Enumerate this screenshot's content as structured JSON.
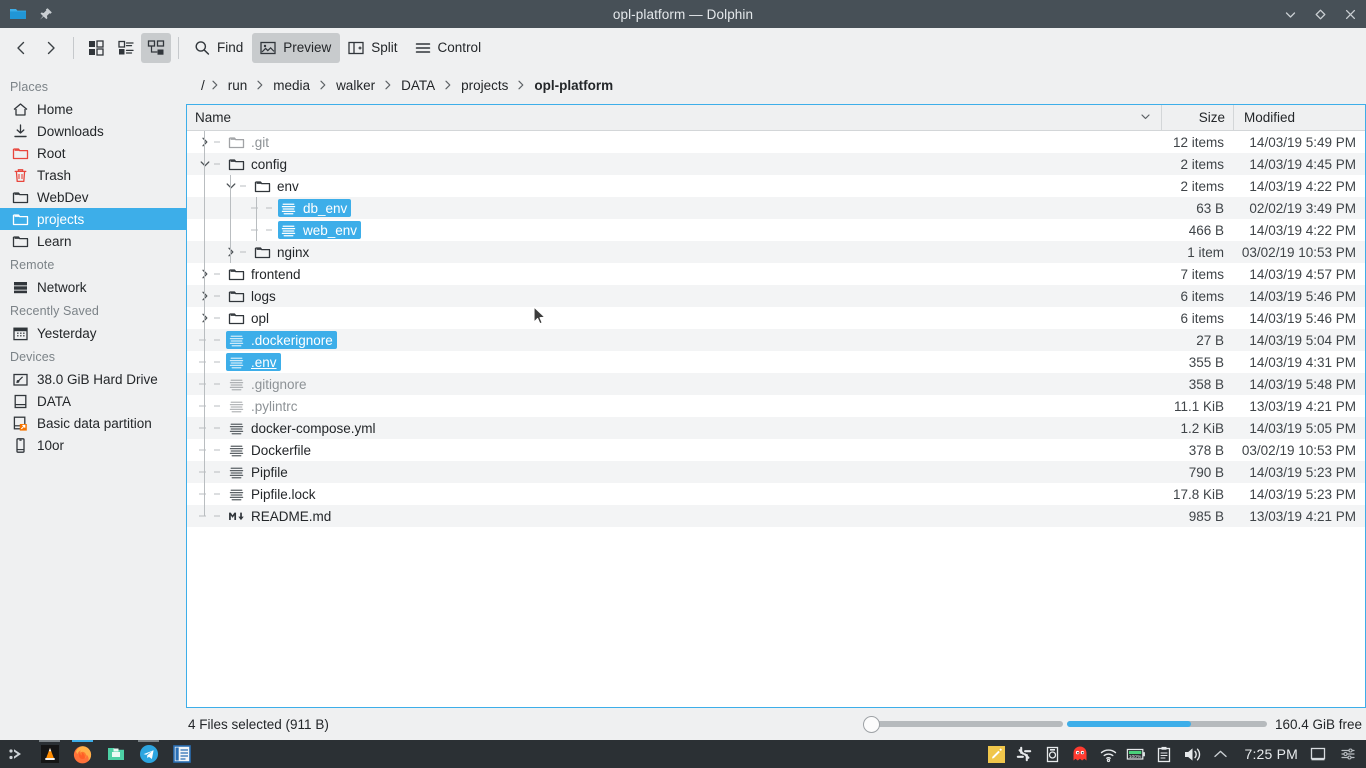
{
  "window": {
    "title": "opl-platform — Dolphin",
    "app_icon": "folder-icon",
    "pin_icon": "pin-icon",
    "controls": [
      {
        "name": "minimize-button",
        "icon": "chevron-down-icon"
      },
      {
        "name": "maximize-button",
        "icon": "diamond-icon"
      },
      {
        "name": "close-button",
        "icon": "close-icon"
      }
    ]
  },
  "toolbar": {
    "back_icon": "chevron-left-icon",
    "forward_icon": "chevron-right-icon",
    "view_icons": "icons-view-icon",
    "view_compact": "compact-view-icon",
    "view_details": "details-view-icon",
    "find_label": "Find",
    "find_icon": "search-icon",
    "preview_label": "Preview",
    "preview_icon": "image-icon",
    "split_label": "Split",
    "split_icon": "split-view-icon",
    "control_label": "Control",
    "control_icon": "hamburger-icon"
  },
  "sidebar": {
    "sections": [
      {
        "title": "Places",
        "items": [
          {
            "label": "Home",
            "icon": "home-icon",
            "selected": false
          },
          {
            "label": "Downloads",
            "icon": "download-icon",
            "selected": false
          },
          {
            "label": "Root",
            "icon": "folder-red-icon",
            "selected": false
          },
          {
            "label": "Trash",
            "icon": "trash-icon",
            "selected": false
          },
          {
            "label": "WebDev",
            "icon": "folder-icon",
            "selected": false
          },
          {
            "label": "projects",
            "icon": "folder-icon",
            "selected": true
          },
          {
            "label": "Learn",
            "icon": "folder-icon",
            "selected": false
          }
        ]
      },
      {
        "title": "Remote",
        "items": [
          {
            "label": "Network",
            "icon": "network-icon",
            "selected": false
          }
        ]
      },
      {
        "title": "Recently Saved",
        "items": [
          {
            "label": "Yesterday",
            "icon": "calendar-icon",
            "selected": false
          }
        ]
      },
      {
        "title": "Devices",
        "items": [
          {
            "label": "38.0 GiB Hard Drive",
            "icon": "harddrive-icon",
            "selected": false
          },
          {
            "label": "DATA",
            "icon": "drive-icon",
            "selected": false
          },
          {
            "label": "Basic data partition",
            "icon": "partition-mounted-icon",
            "selected": false
          },
          {
            "label": "10or",
            "icon": "phone-icon",
            "selected": false
          }
        ]
      }
    ]
  },
  "breadcrumb": {
    "separator": "›",
    "items": [
      {
        "label": "/",
        "current": false
      },
      {
        "label": "run",
        "current": false
      },
      {
        "label": "media",
        "current": false
      },
      {
        "label": "walker",
        "current": false
      },
      {
        "label": "DATA",
        "current": false
      },
      {
        "label": "projects",
        "current": false
      },
      {
        "label": "opl-platform",
        "current": true
      }
    ]
  },
  "filelist": {
    "columns": {
      "name": "Name",
      "size": "Size",
      "modified": "Modified"
    },
    "sort_icon": "chevron-down-icon",
    "rows": [
      {
        "name": ".git",
        "icon": "folder-icon",
        "depth": 0,
        "twisty": "collapsed",
        "size": "12 items",
        "modified": "14/03/19 5:49 PM",
        "selected": false,
        "hidden": true,
        "current": false
      },
      {
        "name": "config",
        "icon": "folder-icon",
        "depth": 0,
        "twisty": "expanded",
        "size": "2 items",
        "modified": "14/03/19 4:45 PM",
        "selected": false,
        "hidden": false,
        "current": false
      },
      {
        "name": "env",
        "icon": "folder-icon",
        "depth": 1,
        "twisty": "expanded",
        "size": "2 items",
        "modified": "14/03/19 4:22 PM",
        "selected": false,
        "hidden": false,
        "current": false
      },
      {
        "name": "db_env",
        "icon": "text-file-icon",
        "depth": 2,
        "twisty": "none",
        "size": "63 B",
        "modified": "02/02/19 3:49 PM",
        "selected": true,
        "hidden": false,
        "current": false
      },
      {
        "name": "web_env",
        "icon": "text-file-icon",
        "depth": 2,
        "twisty": "none",
        "size": "466 B",
        "modified": "14/03/19 4:22 PM",
        "selected": true,
        "hidden": false,
        "current": false
      },
      {
        "name": "nginx",
        "icon": "folder-icon",
        "depth": 1,
        "twisty": "collapsed",
        "size": "1 item",
        "modified": "03/02/19 10:53 PM",
        "selected": false,
        "hidden": false,
        "current": false
      },
      {
        "name": "frontend",
        "icon": "folder-icon",
        "depth": 0,
        "twisty": "collapsed",
        "size": "7 items",
        "modified": "14/03/19 4:57 PM",
        "selected": false,
        "hidden": false,
        "current": false
      },
      {
        "name": "logs",
        "icon": "folder-icon",
        "depth": 0,
        "twisty": "collapsed",
        "size": "6 items",
        "modified": "14/03/19 5:46 PM",
        "selected": false,
        "hidden": false,
        "current": false
      },
      {
        "name": "opl",
        "icon": "folder-icon",
        "depth": 0,
        "twisty": "collapsed",
        "size": "6 items",
        "modified": "14/03/19 5:46 PM",
        "selected": false,
        "hidden": false,
        "current": false
      },
      {
        "name": ".dockerignore",
        "icon": "text-file-icon",
        "depth": 0,
        "twisty": "none",
        "size": "27 B",
        "modified": "14/03/19 5:04 PM",
        "selected": true,
        "hidden": true,
        "current": false
      },
      {
        "name": ".env",
        "icon": "text-file-icon",
        "depth": 0,
        "twisty": "none",
        "size": "355 B",
        "modified": "14/03/19 4:31 PM",
        "selected": true,
        "hidden": true,
        "current": true
      },
      {
        "name": ".gitignore",
        "icon": "text-file-icon",
        "depth": 0,
        "twisty": "none",
        "size": "358 B",
        "modified": "14/03/19 5:48 PM",
        "selected": false,
        "hidden": true,
        "current": false
      },
      {
        "name": ".pylintrc",
        "icon": "text-file-icon",
        "depth": 0,
        "twisty": "none",
        "size": "11.1 KiB",
        "modified": "13/03/19 4:21 PM",
        "selected": false,
        "hidden": true,
        "current": false
      },
      {
        "name": "docker-compose.yml",
        "icon": "text-file-icon",
        "depth": 0,
        "twisty": "none",
        "size": "1.2 KiB",
        "modified": "14/03/19 5:05 PM",
        "selected": false,
        "hidden": false,
        "current": false
      },
      {
        "name": "Dockerfile",
        "icon": "text-file-icon",
        "depth": 0,
        "twisty": "none",
        "size": "378 B",
        "modified": "03/02/19 10:53 PM",
        "selected": false,
        "hidden": false,
        "current": false
      },
      {
        "name": "Pipfile",
        "icon": "text-file-icon",
        "depth": 0,
        "twisty": "none",
        "size": "790 B",
        "modified": "14/03/19 5:23 PM",
        "selected": false,
        "hidden": false,
        "current": false
      },
      {
        "name": "Pipfile.lock",
        "icon": "text-file-icon",
        "depth": 0,
        "twisty": "none",
        "size": "17.8 KiB",
        "modified": "14/03/19 5:23 PM",
        "selected": false,
        "hidden": false,
        "current": false
      },
      {
        "name": "README.md",
        "icon": "markdown-icon",
        "depth": 0,
        "twisty": "none",
        "size": "985 B",
        "modified": "13/03/19 4:21 PM",
        "selected": false,
        "hidden": false,
        "current": false
      }
    ]
  },
  "statusbar": {
    "selection_text": "4 Files selected (911 B)",
    "free_space_text": "160.4 GiB free",
    "zoom_value": 0,
    "space_used_percent": 62
  },
  "taskbar": {
    "launcher_icon": "kde-launcher-icon",
    "apps": [
      {
        "name": "vlc-icon",
        "running": true,
        "active": false
      },
      {
        "name": "firefox-icon",
        "running": true,
        "active": true
      },
      {
        "name": "filemanager-icon",
        "running": false,
        "active": false
      },
      {
        "name": "telegram-icon",
        "running": true,
        "active": false
      },
      {
        "name": "text-editor-icon",
        "running": false,
        "active": false
      }
    ],
    "tray": [
      {
        "name": "notes-icon"
      },
      {
        "name": "slack-icon"
      },
      {
        "name": "device-icon"
      },
      {
        "name": "ghost-icon"
      },
      {
        "name": "wifi-icon"
      },
      {
        "name": "battery-icon",
        "label": "100%"
      },
      {
        "name": "clipboard-icon"
      },
      {
        "name": "volume-icon"
      },
      {
        "name": "tray-expand-icon"
      }
    ],
    "clock": "7:25 PM",
    "right_icons": [
      {
        "name": "show-desktop-icon"
      },
      {
        "name": "settings-icon"
      }
    ]
  },
  "colors": {
    "accent": "#3daee9",
    "titlebar": "#475057",
    "chrome": "#eff0f1",
    "taskbar": "#2b3034",
    "text": "#232629"
  }
}
